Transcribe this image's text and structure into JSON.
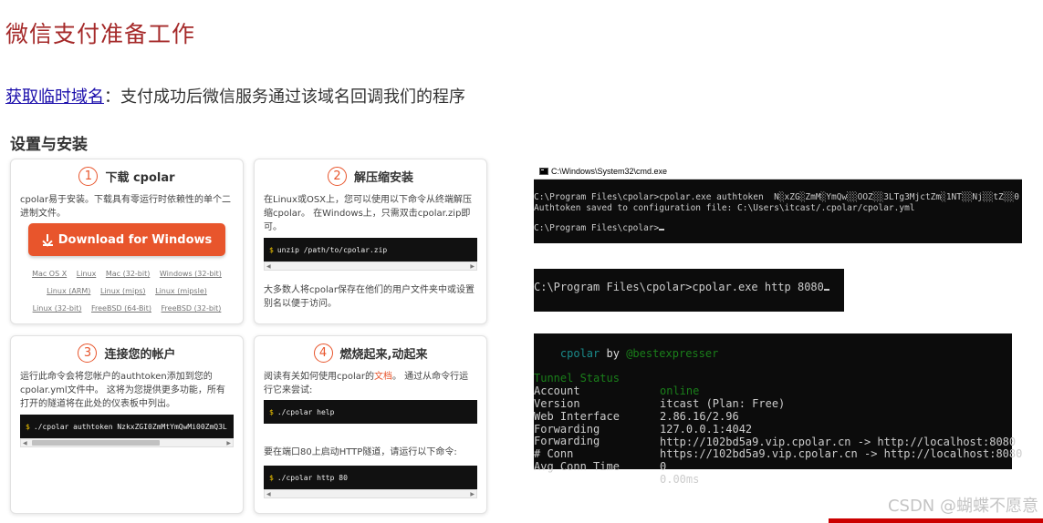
{
  "title": "微信支付准备工作",
  "domain_link": "获取临时域名",
  "domain_desc": "：支付成功后微信服务通过该域名回调我们的程序",
  "setup_title": "设置与安装",
  "steps": [
    {
      "num": "1",
      "title": "下载 cpolar",
      "desc": "cpolar易于安装。下载具有零运行时依赖性的单个二进制文件。",
      "button": "Download for Windows",
      "os_row1": [
        "Mac OS X",
        "Linux",
        "Mac (32-bit)",
        "Windows (32-bit)"
      ],
      "os_row2": [
        "Linux (ARM)",
        "Linux (mips)",
        "Linux (mipsle)"
      ],
      "os_row3": [
        "Linux (32-bit)",
        "FreeBSD (64-Bit)",
        "FreeBSD (32-bit)"
      ]
    },
    {
      "num": "2",
      "title": "解压缩安装",
      "desc": "在Linux或OSX上，您可以使用以下命令从终端解压缩cpolar。 在Windows上，只需双击cpolar.zip即可。",
      "command": "unzip /path/to/cpolar.zip",
      "note": "大多数人将cpolar保存在他们的用户文件夹中或设置别名以便于访问。"
    },
    {
      "num": "3",
      "title": "连接您的帐户",
      "desc": "运行此命令会将您帐户的authtoken添加到您的cpolar.yml文件中。 这将为您提供更多功能，所有打开的隧道将在此处的仪表板中列出。",
      "command": "./cpolar authtoken NzkxZGI0ZmMtYmQwMi00ZmQ3L"
    },
    {
      "num": "4",
      "title": "燃烧起来,动起来",
      "desc_pre": "阅读有关如何使用cpolar的",
      "desc_link": "文档",
      "desc_post": "。 通过从命令行运行它来尝试:",
      "command1": "./cpolar help",
      "note": "要在端口80上启动HTTP隧道，请运行以下命令:",
      "command2": "./cpolar http 80"
    }
  ],
  "prompt_symbol": "$",
  "cmd_window": {
    "title": "C:\\Windows\\System32\\cmd.exe",
    "line1": "C:\\Program Files\\cpolar>cpolar.exe authtoken  N░xZG░ZmM░YmQw░░OOZ░░3LTg3MjctZm░1NT░░Nj░░tZ░░0",
    "line2": "Authtoken saved to configuration file: C:\\Users\\itcast/.cpolar/cpolar.yml",
    "line3": "C:\\Program Files\\cpolar>"
  },
  "cmd_http": "C:\\Program Files\\cpolar>cpolar.exe http 8080",
  "cpolar_status": {
    "brand": "cpolar",
    "by": "by",
    "author": "@bestexpresser",
    "rows": [
      {
        "key": "Tunnel Status",
        "value": "online"
      },
      {
        "key": "Account",
        "value": "itcast (Plan: Free)"
      },
      {
        "key": "Version",
        "value": "2.86.16/2.96"
      },
      {
        "key": "Web Interface",
        "value": "127.0.0.1:4042"
      },
      {
        "key": "Forwarding",
        "value": "http://102bd5a9.vip.cpolar.cn -> http://localhost:8080"
      },
      {
        "key": "Forwarding",
        "value": "https://102bd5a9.vip.cpolar.cn -> http://localhost:8080"
      },
      {
        "key": "# Conn",
        "value": "0"
      },
      {
        "key": "Avg Conn Time",
        "value": "0.00ms"
      }
    ]
  },
  "watermark": "CSDN @蝴蝶不愿意",
  "colors": {
    "accent": "#e8552c",
    "title": "#a52a2a",
    "status_green": "#1a7f1a",
    "brand_cyan": "#1a8a8a"
  }
}
